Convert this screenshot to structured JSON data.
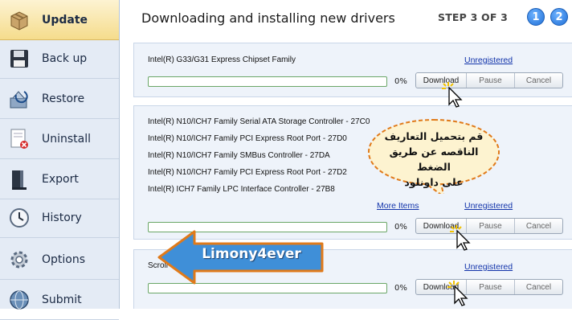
{
  "sidebar": {
    "items": [
      {
        "label": "Update",
        "icon": "box-icon",
        "active": true
      },
      {
        "label": "Back up",
        "icon": "floppy-icon"
      },
      {
        "label": "Restore",
        "icon": "restore-icon"
      },
      {
        "label": "Uninstall",
        "icon": "uninstall-icon"
      },
      {
        "label": "Export",
        "icon": "export-icon"
      },
      {
        "label": "History",
        "icon": "clock-icon"
      },
      {
        "label": "Options",
        "icon": "gear-icon"
      },
      {
        "label": "Submit",
        "icon": "globe-icon"
      }
    ]
  },
  "header": {
    "title": "Downloading and installing new drivers",
    "step": "STEP 3 OF 3",
    "step_circles": [
      "1",
      "2"
    ]
  },
  "panels": [
    {
      "drivers": [
        "Intel(R) G33/G31 Express Chipset Family"
      ],
      "link": "Unregistered",
      "progress_percent": "0%",
      "progress_value": 0,
      "buttons": {
        "download": "Download",
        "pause": "Pause",
        "cancel": "Cancel"
      }
    },
    {
      "drivers": [
        "Intel(R) N10/ICH7 Family Serial ATA Storage Controller - 27C0",
        "Intel(R) N10/ICH7 Family PCI Express Root Port - 27D0",
        "Intel(R) N10/ICH7 Family SMBus Controller - 27DA",
        "Intel(R) N10/ICH7 Family PCI Express Root Port - 27D2",
        "Intel(R) ICH7 Family LPC Interface Controller - 27B8"
      ],
      "more_link": "More Items",
      "link": "Unregistered",
      "progress_percent": "0%",
      "progress_value": 0,
      "buttons": {
        "download": "Download",
        "pause": "Pause",
        "cancel": "Cancel"
      }
    },
    {
      "drivers": [
        "Scroll"
      ],
      "link": "Unregistered",
      "progress_percent": "0%",
      "progress_value": 0,
      "buttons": {
        "download": "Download",
        "pause": "Pause",
        "cancel": "Cancel"
      }
    }
  ],
  "annotation": {
    "bubble_lines": [
      "قم بتحميل التعاريف",
      "الناقصه عن طريق الضغط",
      "على داونلود"
    ],
    "arrow_text": "Limony4ever"
  },
  "colors": {
    "sidebar_bg": "#e4ebf5",
    "active_item": "#f5dc8c",
    "panel_bg": "#eef3fa",
    "progress_border": "#6aa667",
    "link": "#1133aa",
    "bubble_fill": "#fdf3d0",
    "bubble_border": "#e07a1a",
    "arrow_fill": "#3f8fd8",
    "arrow_border": "#e07a1a"
  }
}
